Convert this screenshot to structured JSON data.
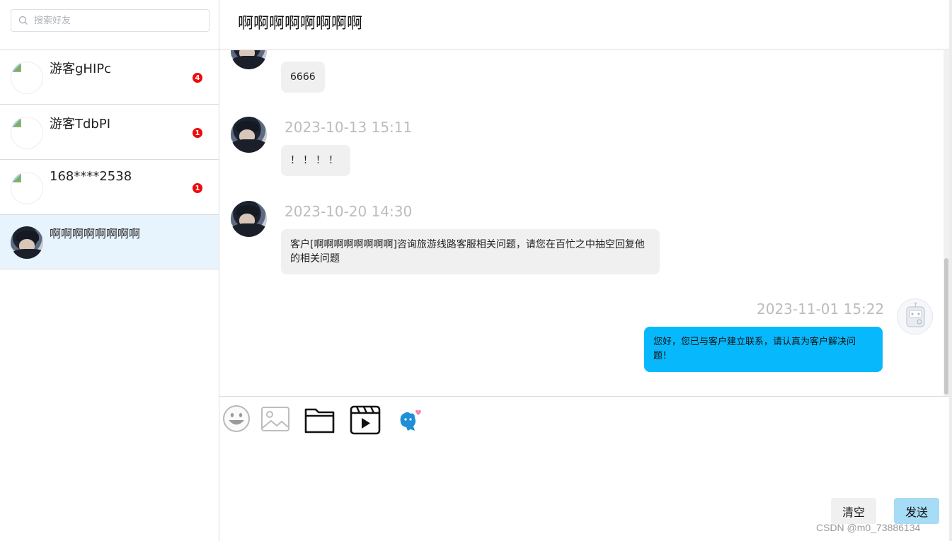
{
  "search": {
    "placeholder": "搜索好友"
  },
  "contacts": [
    {
      "name": "游客gHIPc",
      "unread": "4"
    },
    {
      "name": "游客TdbPI",
      "unread": "1"
    },
    {
      "name": "168****2538",
      "unread": "1"
    },
    {
      "name": "啊啊啊啊啊啊啊啊",
      "unread": ""
    }
  ],
  "chat": {
    "title": "啊啊啊啊啊啊啊啊",
    "messages": [
      {
        "sender": "customer",
        "time": "",
        "text": "6666"
      },
      {
        "sender": "customer",
        "time": "2023-10-13 15:11",
        "text": "！！！！"
      },
      {
        "sender": "customer",
        "time": "2023-10-20 14:30",
        "text": "客户[啊啊啊啊啊啊啊啊]咨询旅游线路客服相关问题，请您在百忙之中抽空回复他的相关问题"
      },
      {
        "sender": "agent",
        "time": "2023-11-01 15:22",
        "text": "您好，您已与客户建立联系，请认真为客户解决问题！"
      }
    ]
  },
  "toolbar": {
    "icons": [
      "emoji-icon",
      "image-icon",
      "folder-icon",
      "video-icon",
      "mascot-icon"
    ]
  },
  "composer": {
    "clear_label": "清空",
    "send_label": "发送"
  },
  "watermark": "CSDN @m0_73886134",
  "colors": {
    "agent_bubble": "#07b9fc",
    "customer_bubble": "#f0f0f0",
    "badge": "#ee0a0a",
    "active_contact": "#e7f3fd",
    "send_button": "#a7dcf6"
  }
}
